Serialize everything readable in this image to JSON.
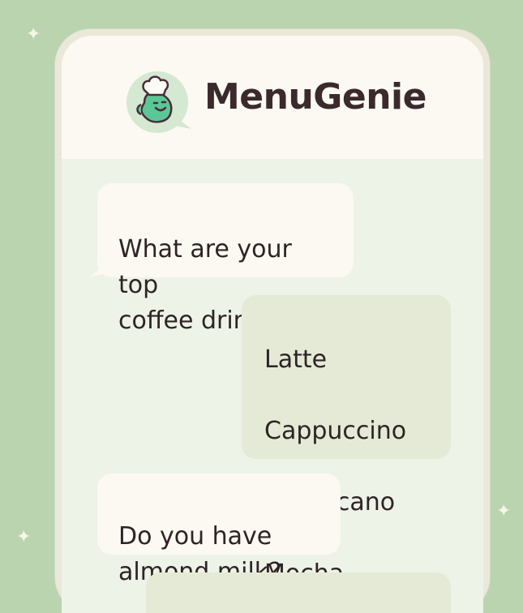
{
  "app": {
    "title": "MenuGenie",
    "logo_icon": "chef-blob-icon",
    "accent_color": "#5cc796",
    "background_color": "#b9d4ae"
  },
  "messages": [
    {
      "role": "user",
      "text": "What are your top\ncoffee drinks?"
    },
    {
      "role": "bot",
      "items": [
        "Latte",
        "Cappuccino",
        "Americano",
        "Mocha"
      ]
    },
    {
      "role": "user",
      "text": "Do you have\nalmond milk?"
    },
    {
      "role": "bot",
      "text": ""
    }
  ]
}
